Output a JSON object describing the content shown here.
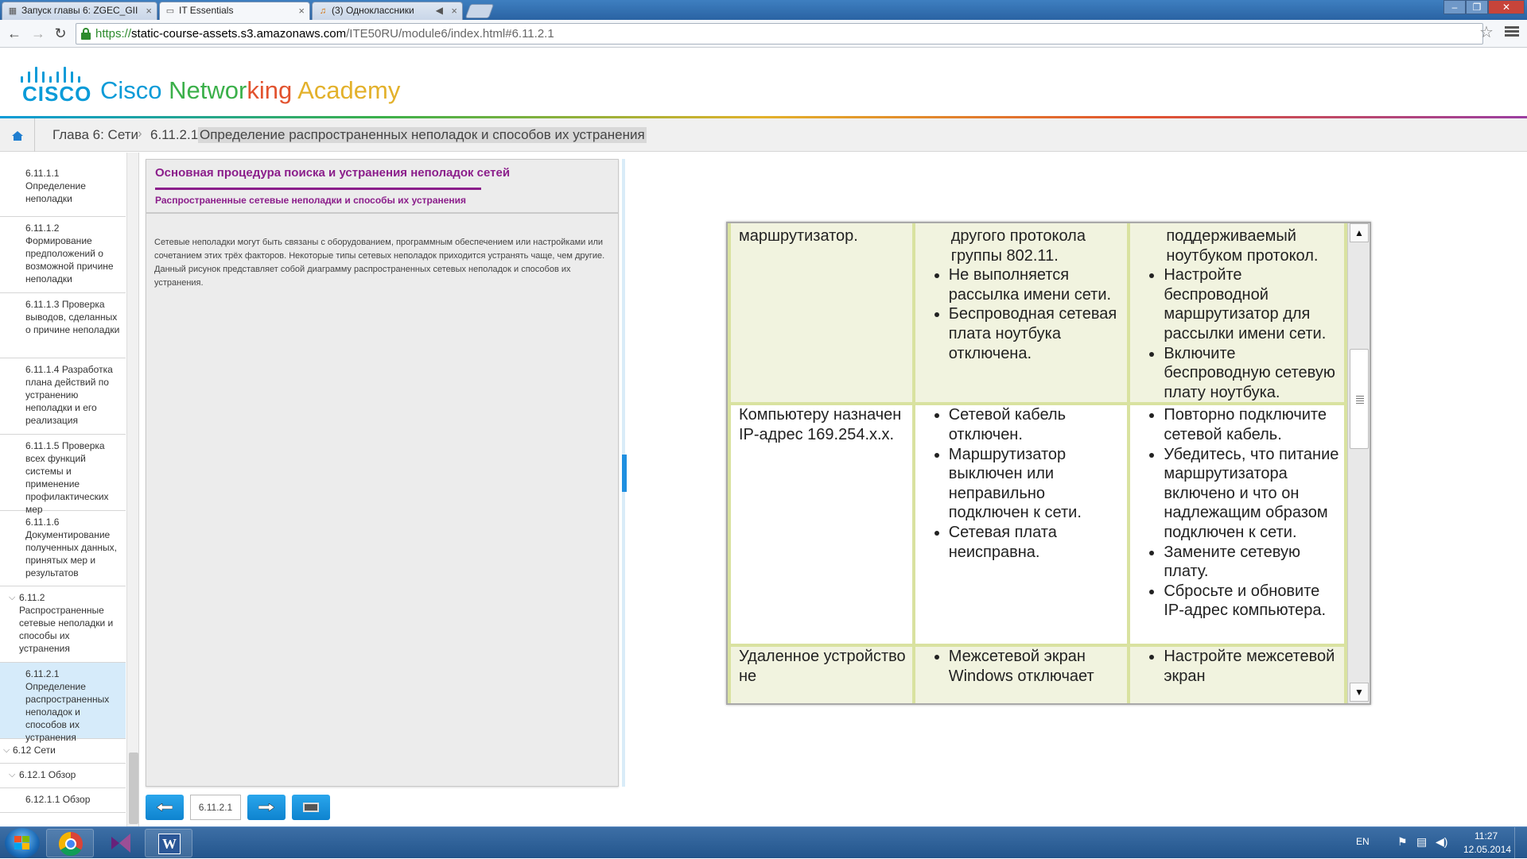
{
  "browser": {
    "tabs": [
      {
        "label": "Запуск главы 6: ZGEC_GII",
        "icon": "page-icon",
        "active": false
      },
      {
        "label": "IT Essentials",
        "icon": "page-icon",
        "active": true
      },
      {
        "label": "(3) Одноклассники",
        "icon": "music-icon",
        "active": false
      }
    ],
    "url_scheme": "https://",
    "url_host": "static-course-assets.s3.amazonaws.com",
    "url_path": "/ITE50RU/module6/index.html#6.11.2.1"
  },
  "header": {
    "cisco_word": "CISCO",
    "academy_parts": [
      "Cisco",
      " Networ",
      "king",
      " Academy"
    ],
    "academy_colors": [
      "#0a9bd8",
      "#3bb04a",
      "#e2532f",
      "#e3b12b"
    ]
  },
  "breadcrumb": {
    "chapter": "Глава 6: Сети",
    "section_number": "6.11.2.1",
    "section_title": "Определение распространенных неполадок и способов их устранения"
  },
  "sidebar": {
    "items": [
      {
        "label": "6.11.1.1 Определение неполадки",
        "level": "sub",
        "active": false
      },
      {
        "label": "6.11.1.2 Формирование предположений о возможной причине неполадки",
        "level": "sub",
        "active": false
      },
      {
        "label": "6.11.1.3 Проверка выводов, сделанных о причине неполадки",
        "level": "sub",
        "active": false
      },
      {
        "label": "6.11.1.4 Разработка плана действий по устранению неполадки и его реализация",
        "level": "sub",
        "active": false
      },
      {
        "label": "6.11.1.5 Проверка всех функций системы и применение профилактических мер",
        "level": "sub",
        "active": false
      },
      {
        "label": "6.11.1.6 Документирование полученных данных, принятых мер и результатов",
        "level": "sub",
        "active": false
      },
      {
        "label": "6.11.2 Распространенные сетевые неполадки и способы их устранения",
        "level": "sec",
        "active": false
      },
      {
        "label": "6.11.2.1 Определение распространенных неполадок и способов их устранения",
        "level": "sub",
        "active": true
      },
      {
        "label": "6.12 Сети",
        "level": "top",
        "active": false
      },
      {
        "label": "6.12.1 Обзор",
        "level": "sec",
        "active": false
      },
      {
        "label": "6.12.1.1 Обзор",
        "level": "sub",
        "active": false
      }
    ]
  },
  "panel": {
    "title": "Основная процедура поиска и устранения неполадок сетей",
    "subtitle": "Распространенные сетевые неполадки и способы их устранения",
    "body": "Сетевые неполадки могут быть связаны с оборудованием, программным обеспечением или настройками или сочетанием этих трёх факторов. Некоторые типы сетевых неполадок приходится устранять чаще, чем другие. Данный рисунок представляет собой диаграмму распространенных сетевых неполадок и способов их устранения."
  },
  "bottom_nav": {
    "page_number": "6.11.2.1"
  },
  "table": {
    "rows": [
      {
        "problem": "маршрутизатор.",
        "causes": [
          "другого протокола группы 802.11.",
          "Не выполняется рассылка имени сети.",
          "Беспроводная сетевая плата ноутбука отключена."
        ],
        "solutions": [
          "поддерживаемый ноутбуком протокол.",
          "Настройте беспроводной маршрутизатор для рассылки имени сети.",
          "Включите беспроводную сетевую плату ноутбука."
        ]
      },
      {
        "problem": "Компьютеру назначен IP-адрес 169.254.x.x.",
        "causes": [
          "Сетевой кабель отключен.",
          "Маршрутизатор выключен или неправильно подключен к сети.",
          "Сетевая плата неисправна."
        ],
        "solutions": [
          "Повторно подключите сетевой кабель.",
          "Убедитесь, что питание маршрутизатора включено и что он надлежащим образом подключен к сети.",
          "Замените сетевую плату.",
          "Сбросьте и обновите IP-адрес компьютера."
        ]
      },
      {
        "problem": "Удаленное устройство не",
        "causes": [
          "Межсетевой экран Windows отключает"
        ],
        "solutions": [
          "Настройте межсетевой экран"
        ]
      }
    ]
  },
  "taskbar": {
    "language": "EN",
    "time": "11:27",
    "date": "12.05.2014"
  }
}
